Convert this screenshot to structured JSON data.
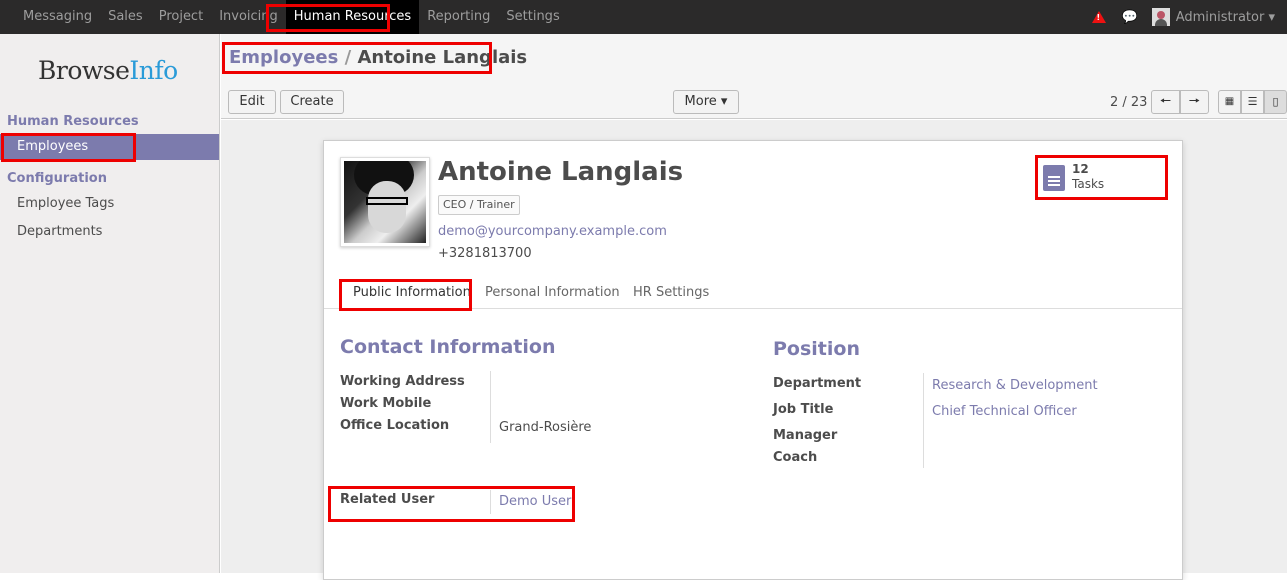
{
  "topbar": {
    "menu": [
      "Messaging",
      "Sales",
      "Project",
      "Invoicing",
      "Human Resources",
      "Reporting",
      "Settings"
    ],
    "active": "Human Resources",
    "user": "Administrator"
  },
  "sidebar": {
    "logo_left": "Browse",
    "logo_right": "Info",
    "section1": "Human Resources",
    "employees": "Employees",
    "section2": "Configuration",
    "tags": "Employee Tags",
    "departments": "Departments"
  },
  "control": {
    "bc_parent": "Employees",
    "bc_sep": " / ",
    "bc_current": "Antoine Langlais",
    "edit": "Edit",
    "create": "Create",
    "more": "More",
    "pager": "2 / 23"
  },
  "employee": {
    "name": "Antoine Langlais",
    "tag": "CEO / Trainer",
    "email": "demo@yourcompany.example.com",
    "phone": "+3281813700",
    "tasks_count": "12",
    "tasks_label": "Tasks"
  },
  "tabs": [
    "Public Information",
    "Personal Information",
    "HR Settings"
  ],
  "contact": {
    "title": "Contact Information",
    "working_address": "Working Address",
    "work_mobile": "Work Mobile",
    "office_location": "Office Location",
    "office_location_value": "Grand-Rosière",
    "related_user": "Related User",
    "related_user_value": "Demo User"
  },
  "position": {
    "title": "Position",
    "department": "Department",
    "department_value": "Research & Development",
    "job_title": "Job Title",
    "job_title_value": "Chief Technical Officer",
    "manager": "Manager",
    "coach": "Coach"
  },
  "colors": {
    "accent": "#7c7bad",
    "highlight": "#ee0000",
    "topbar": "#2b2a2a"
  }
}
